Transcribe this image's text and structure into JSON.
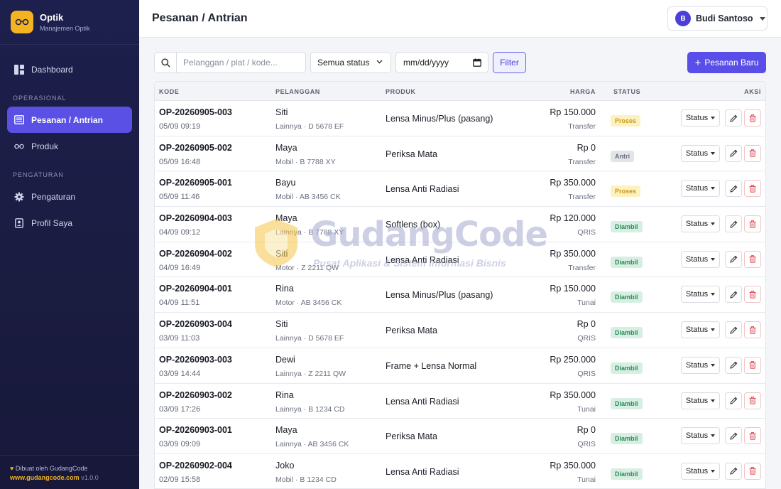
{
  "brand": {
    "name": "Optik",
    "subtitle": "Manajemen Optik",
    "icon": "glasses-icon"
  },
  "sidebar": {
    "items": [
      {
        "label": "Dashboard",
        "icon": "dashboard-icon"
      },
      {
        "label": "Pesanan / Antrian",
        "icon": "list-icon",
        "active": true
      },
      {
        "label": "Produk",
        "icon": "glasses-icon"
      },
      {
        "label": "Pengaturan",
        "icon": "gear-icon"
      },
      {
        "label": "Profil Saya",
        "icon": "profile-icon"
      }
    ],
    "section_operasional": "OPERASIONAL",
    "section_pengaturan": "PENGATURAN",
    "footer": {
      "made_by": "Dibuat oleh GudangCode",
      "site": "www.gudangcode.com",
      "version": "v1.0.0"
    }
  },
  "header": {
    "title": "Pesanan / Antrian",
    "user_initial": "B",
    "user_name": "Budi Santoso"
  },
  "filters": {
    "search_placeholder": "Pelanggan / plat / kode...",
    "status_select": "Semua status",
    "date_placeholder": "mm/dd/yyyy",
    "filter_label": "Filter",
    "new_label": "Pesanan Baru"
  },
  "table": {
    "headers": {
      "kode": "KODE",
      "pelanggan": "PELANGGAN",
      "produk": "PRODUK",
      "harga": "HARGA",
      "status": "STATUS",
      "aksi": "AKSI"
    },
    "status_button": "Status",
    "rows": [
      {
        "kode": "OP-20260905-003",
        "tgl": "05/09 09:19",
        "pelanggan": "Siti",
        "kendaraan": "Lainnya · D 5678 EF",
        "produk": "Lensa Minus/Plus (pasang)",
        "harga": "Rp 150.000",
        "bayar": "Transfer",
        "status": "Proses",
        "status_type": "proses"
      },
      {
        "kode": "OP-20260905-002",
        "tgl": "05/09 16:48",
        "pelanggan": "Maya",
        "kendaraan": "Mobil · B 7788 XY",
        "produk": "Periksa Mata",
        "harga": "Rp 0",
        "bayar": "Transfer",
        "status": "Antri",
        "status_type": "antri"
      },
      {
        "kode": "OP-20260905-001",
        "tgl": "05/09 11:46",
        "pelanggan": "Bayu",
        "kendaraan": "Mobil · AB 3456 CK",
        "produk": "Lensa Anti Radiasi",
        "harga": "Rp 350.000",
        "bayar": "Transfer",
        "status": "Proses",
        "status_type": "proses"
      },
      {
        "kode": "OP-20260904-003",
        "tgl": "04/09 09:12",
        "pelanggan": "Maya",
        "kendaraan": "Lainnya · B 7788 XY",
        "produk": "Softlens (box)",
        "harga": "Rp 120.000",
        "bayar": "QRIS",
        "status": "Diambil",
        "status_type": "diambil"
      },
      {
        "kode": "OP-20260904-002",
        "tgl": "04/09 16:49",
        "pelanggan": "Siti",
        "kendaraan": "Motor · Z 2211 QW",
        "produk": "Lensa Anti Radiasi",
        "harga": "Rp 350.000",
        "bayar": "Transfer",
        "status": "Diambil",
        "status_type": "diambil"
      },
      {
        "kode": "OP-20260904-001",
        "tgl": "04/09 11:51",
        "pelanggan": "Rina",
        "kendaraan": "Motor · AB 3456 CK",
        "produk": "Lensa Minus/Plus (pasang)",
        "harga": "Rp 150.000",
        "bayar": "Tunai",
        "status": "Diambil",
        "status_type": "diambil"
      },
      {
        "kode": "OP-20260903-004",
        "tgl": "03/09 11:03",
        "pelanggan": "Siti",
        "kendaraan": "Lainnya · D 5678 EF",
        "produk": "Periksa Mata",
        "harga": "Rp 0",
        "bayar": "QRIS",
        "status": "Diambil",
        "status_type": "diambil"
      },
      {
        "kode": "OP-20260903-003",
        "tgl": "03/09 14:44",
        "pelanggan": "Dewi",
        "kendaraan": "Lainnya · Z 2211 QW",
        "produk": "Frame + Lensa Normal",
        "harga": "Rp 250.000",
        "bayar": "QRIS",
        "status": "Diambil",
        "status_type": "diambil"
      },
      {
        "kode": "OP-20260903-002",
        "tgl": "03/09 17:26",
        "pelanggan": "Rina",
        "kendaraan": "Lainnya · B 1234 CD",
        "produk": "Lensa Anti Radiasi",
        "harga": "Rp 350.000",
        "bayar": "Tunai",
        "status": "Diambil",
        "status_type": "diambil"
      },
      {
        "kode": "OP-20260903-001",
        "tgl": "03/09 09:09",
        "pelanggan": "Maya",
        "kendaraan": "Lainnya · AB 3456 CK",
        "produk": "Periksa Mata",
        "harga": "Rp 0",
        "bayar": "QRIS",
        "status": "Diambil",
        "status_type": "diambil"
      },
      {
        "kode": "OP-20260902-004",
        "tgl": "02/09 15:58",
        "pelanggan": "Joko",
        "kendaraan": "Mobil · B 1234 CD",
        "produk": "Lensa Anti Radiasi",
        "harga": "Rp 350.000",
        "bayar": "Tunai",
        "status": "Diambil",
        "status_type": "diambil"
      }
    ]
  },
  "watermark": {
    "title": "GudangCode",
    "subtitle": "Pusat Aplikasi & Sistem Informasi Bisnis"
  },
  "colors": {
    "accent": "#5a4ee8",
    "sidebar": "#1d1f4d",
    "brand_yellow": "#f4b321"
  }
}
